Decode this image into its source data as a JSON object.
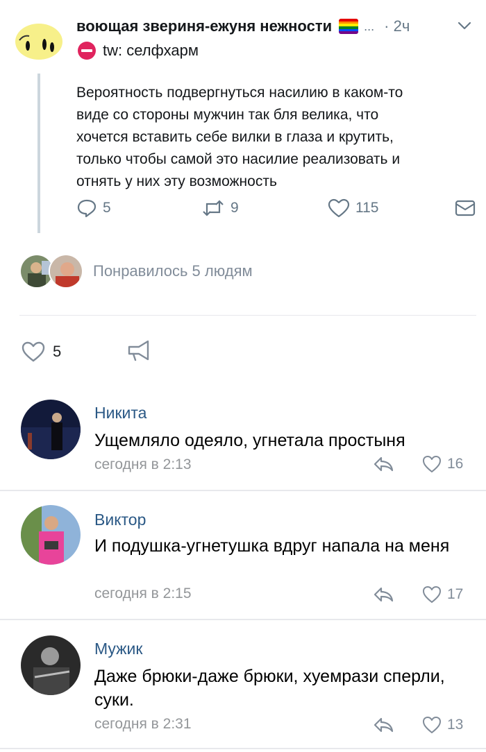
{
  "tweet": {
    "author_name": "воющая звериня-ежуня нежности",
    "ellipsis": "...",
    "time": "· 2ч",
    "trigger_warning": "tw: селфхарм",
    "body": "Вероятность подвергнуться насилию в каком-то\nвиде со стороны мужчин так бля велика, что\nхочется вставить себе вилки в глаза и крутить,\nтолько чтобы самой это насилие реализовать и\nотнять у них эту возможность",
    "replies": "5",
    "retweets": "9",
    "likes": "115",
    "icons": [
      "chevron-down-icon",
      "no-entry-icon",
      "reply-icon",
      "retweet-icon",
      "heart-icon",
      "dm-envelope-icon"
    ]
  },
  "liked_by": {
    "text": "Понравилось 5 людям"
  },
  "post": {
    "likes": "5",
    "icons": [
      "heart-icon",
      "share-icon"
    ]
  },
  "comments": [
    {
      "name": "Никита",
      "text": "Ущемляло одеяло, угнетала простыня",
      "date": "сегодня в 2:13",
      "likes": "16"
    },
    {
      "name": "Виктор",
      "text": "И подушка-угнетушка вдруг напала на меня",
      "date": "сегодня в 2:15",
      "likes": "17"
    },
    {
      "name": "Мужик",
      "text": "Даже брюки-даже брюки, хуемрази сперли, суки.",
      "date": "сегодня в 2:31",
      "likes": "13"
    }
  ],
  "colors": {
    "link_blue": "#2a5885",
    "muted_gray": "#818c99",
    "tweet_text": "#14171a",
    "tweet_gray": "#657786",
    "divider": "#e7e8ec"
  }
}
